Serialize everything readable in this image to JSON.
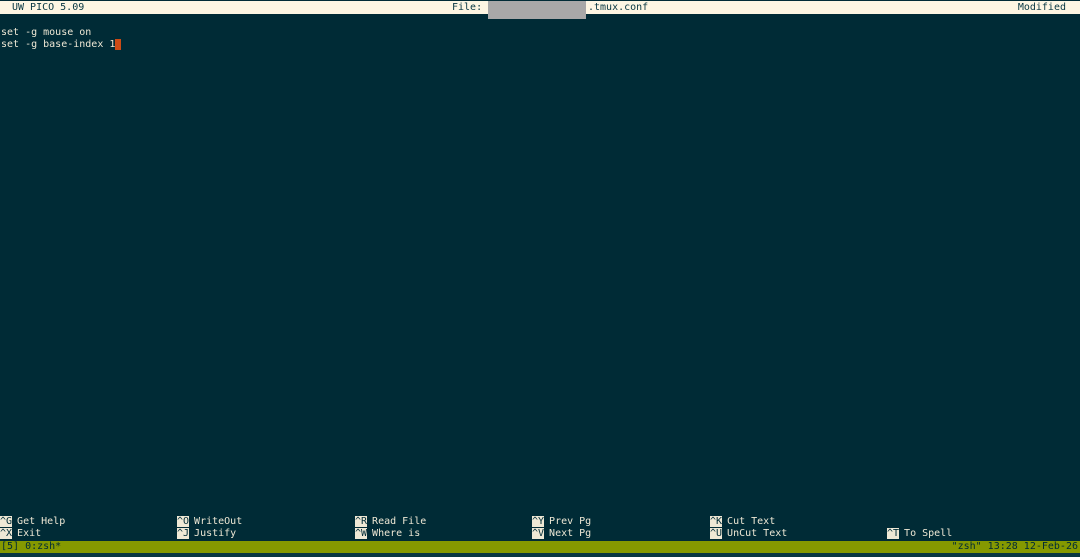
{
  "titlebar": {
    "app": "UW PICO 5.09",
    "file_label": "File:",
    "file_name": ".tmux.conf",
    "status": "Modified"
  },
  "editor": {
    "lines": [
      "set -g mouse on",
      "set -g base-index 1"
    ]
  },
  "help_menu": [
    {
      "key": "^G",
      "label": "Get Help"
    },
    {
      "key": "^X",
      "label": "Exit"
    },
    {
      "key": "^O",
      "label": "WriteOut"
    },
    {
      "key": "^J",
      "label": "Justify"
    },
    {
      "key": "^R",
      "label": "Read File"
    },
    {
      "key": "^W",
      "label": "Where is"
    },
    {
      "key": "^Y",
      "label": "Prev Pg"
    },
    {
      "key": "^V",
      "label": "Next Pg"
    },
    {
      "key": "^K",
      "label": "Cut Text"
    },
    {
      "key": "^U",
      "label": "UnCut Text"
    },
    {
      "key": "^T",
      "label": "To Spell"
    }
  ],
  "tmux": {
    "left": "[5] 0:zsh*",
    "right": "\"zsh\" 13:28 12-Feb-26"
  },
  "colors": {
    "background": "#002b36",
    "titlebar": "#fdf6e3",
    "cursor": "#cb4b16",
    "statusbar": "#859900"
  }
}
